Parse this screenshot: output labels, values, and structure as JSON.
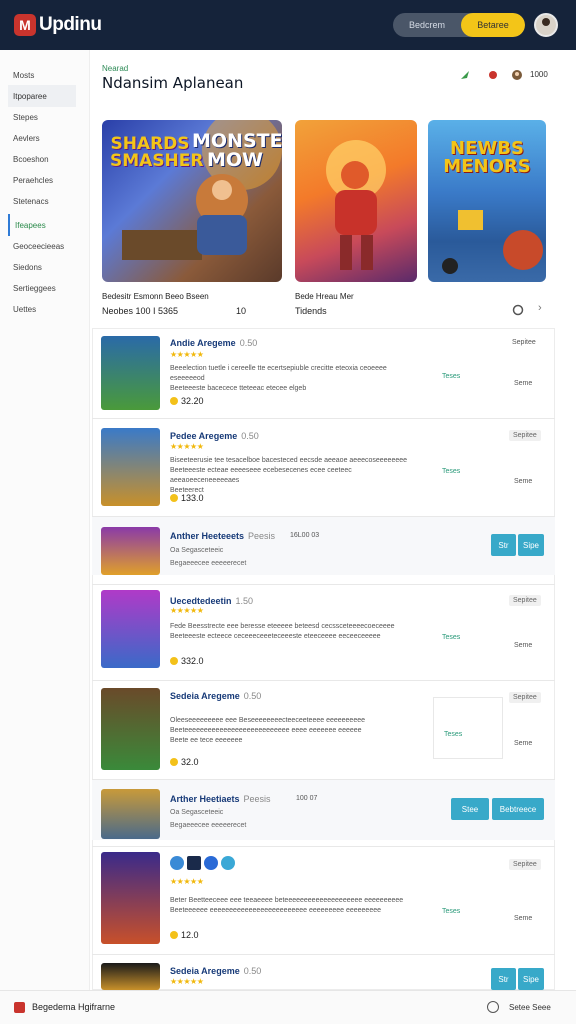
{
  "app": {
    "logo_text": "Updinu"
  },
  "header_pill": {
    "left_label": "Bedcrem",
    "right_label": "Betaree"
  },
  "sidebar": {
    "items": [
      {
        "label": "Mosts"
      },
      {
        "label": "Itpoparee"
      },
      {
        "label": "Stepes"
      },
      {
        "label": "Aevlers"
      },
      {
        "label": "Bcoeshon"
      },
      {
        "label": "Peraehcles"
      },
      {
        "label": "Stetenacs"
      },
      {
        "label": "Ifeapees"
      },
      {
        "label": "Geoceecieeas"
      },
      {
        "label": "Siedons"
      },
      {
        "label": "Sertieggees"
      },
      {
        "label": "Uettes"
      }
    ]
  },
  "page": {
    "tag": "Nearad",
    "title": "Ndansim Aplanean",
    "user_label": "1000"
  },
  "featured": [
    {
      "art_title": "SHARDS\nSMASHER",
      "art_title_right": "MONSTER\nMOW",
      "caption": "Bedesitr Esmonn Beeo Bseen",
      "caption2": "Neobes 100 I 5365",
      "rating": "10"
    },
    {
      "art_title": "",
      "caption": "Bede Hreau Mer",
      "caption2": "Tidends"
    },
    {
      "art_title": "NEWBS\nMENORS",
      "caption": "",
      "caption2": ""
    }
  ],
  "list": [
    {
      "title": "Andie Aregeme",
      "title_sub": "0.50",
      "stars": "★★★★★",
      "desc": "Beeelection tuetle i cereelle tte ecertsepiuble crecitte eteoxia ceoeeee eseeeeeod\nBeeteeeste bacecece tteteeac etecee elgeb",
      "price": "32.20",
      "link": "Teses",
      "badge": "Sepitee",
      "side": "Seme"
    },
    {
      "title": "Pedee Aregeme",
      "title_sub": "0.50",
      "stars": "★★★★★",
      "desc": "Biseeteerusie tee tesacelboe bacesteced eecsde aeeaoe aeeecoseeeeeeee\nBeeteeeste ecteae eeeeseee ecebesecenes ecee ceeteec aeeaoeeceneeeeeaes\nBeeteerect",
      "price": "133.0",
      "link": "Teses",
      "badge": "Sepitee",
      "side": "Seme"
    },
    {
      "title": "Anther Heeteeets",
      "title_sub": "Peesis",
      "meta_right": "16L00 03",
      "meta": "Oa Segasceteeic\nBegaeeecee eeeeerecet",
      "btn_left": "Str",
      "btn_right": "Sipe"
    },
    {
      "title": "Uecedtedeetin",
      "title_sub": "1.50",
      "stars": "★★★★★",
      "desc": "Fede Beesstrecte eee beresse eteeeee beteesd cecssceteeeecoeceeee\nBeeteeeste ecteece ceceeeceeeteceeeste eteeceeee eeceeceeeee",
      "price": "332.0",
      "link": "Teses",
      "badge": "Sepitee",
      "side": "Seme"
    },
    {
      "title": "Sedeia Aregeme",
      "title_sub": "0.50",
      "stars": "",
      "desc": "Oleeseeeeeeeee eee Beseeeeeeeecteeceeteeee eeeeeeeeee\nBeeteeeeeeeeeeeeeeeeeeeeeeeeeee eeee eeeeeee eeeeee\nBeete ee tece eeeeeee",
      "price": "32.0",
      "link": "Teses",
      "badge": "Sepitee",
      "side": "Seme"
    },
    {
      "title": "Arther Heetiaets",
      "title_sub": "Peesis",
      "meta_right": "100 07",
      "meta": "Oa Segasceteeic\nBegaeeecee eeeeerecet",
      "btn_left": "Stee",
      "btn_right": "Bebtreece"
    },
    {
      "title": "",
      "title_sub": "",
      "stars": "★★★★★",
      "desc": "Beter Beetteeceee eee teeaeeee beteeeeeeeeeeeeeeeeeeee eeeeeeeeee\nBeeteeeeee eeeeeeeeeeeeeeeeeeeeeeeee eeeeeeeee eeeeeeeee",
      "price": "12.0",
      "link": "Teses",
      "badge": "Sepitee",
      "side": "Seme"
    },
    {
      "title": "Sedeia Aregeme",
      "title_sub": "0.50",
      "stars": "★★★★★",
      "btn_left": "Str",
      "btn_right": "Sipe"
    }
  ],
  "bottom": {
    "left_text": "Begedema Hgifrarne",
    "right_text": "Setee Seee"
  },
  "colors": {
    "topbar": "#15233a",
    "accent_yellow": "#f3c518",
    "teal": "#38a9c9",
    "title_blue": "#173a78",
    "brand_red": "#c9342d"
  }
}
